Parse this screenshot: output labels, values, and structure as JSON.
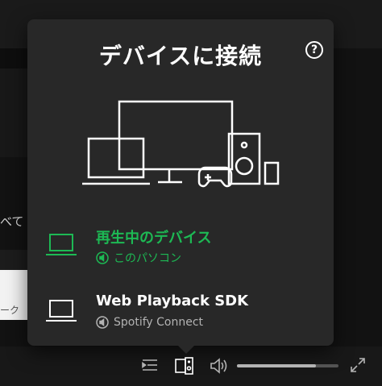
{
  "popover": {
    "title": "デバイスに接続",
    "help_label": "?"
  },
  "devices": [
    {
      "name": "再生中のデバイス",
      "subtitle": "このパソコン",
      "active": true,
      "icon": "laptop-icon"
    },
    {
      "name": "Web Playback SDK",
      "subtitle": "Spotify Connect",
      "active": false,
      "icon": "laptop-icon"
    }
  ],
  "background": {
    "fragment_1": "べて",
    "fragment_2": "ーク"
  },
  "player": {
    "volume_level": 0.78
  },
  "colors": {
    "accent": "#1db954",
    "popover_bg": "#282828",
    "muted_text": "#b3b3b3"
  }
}
